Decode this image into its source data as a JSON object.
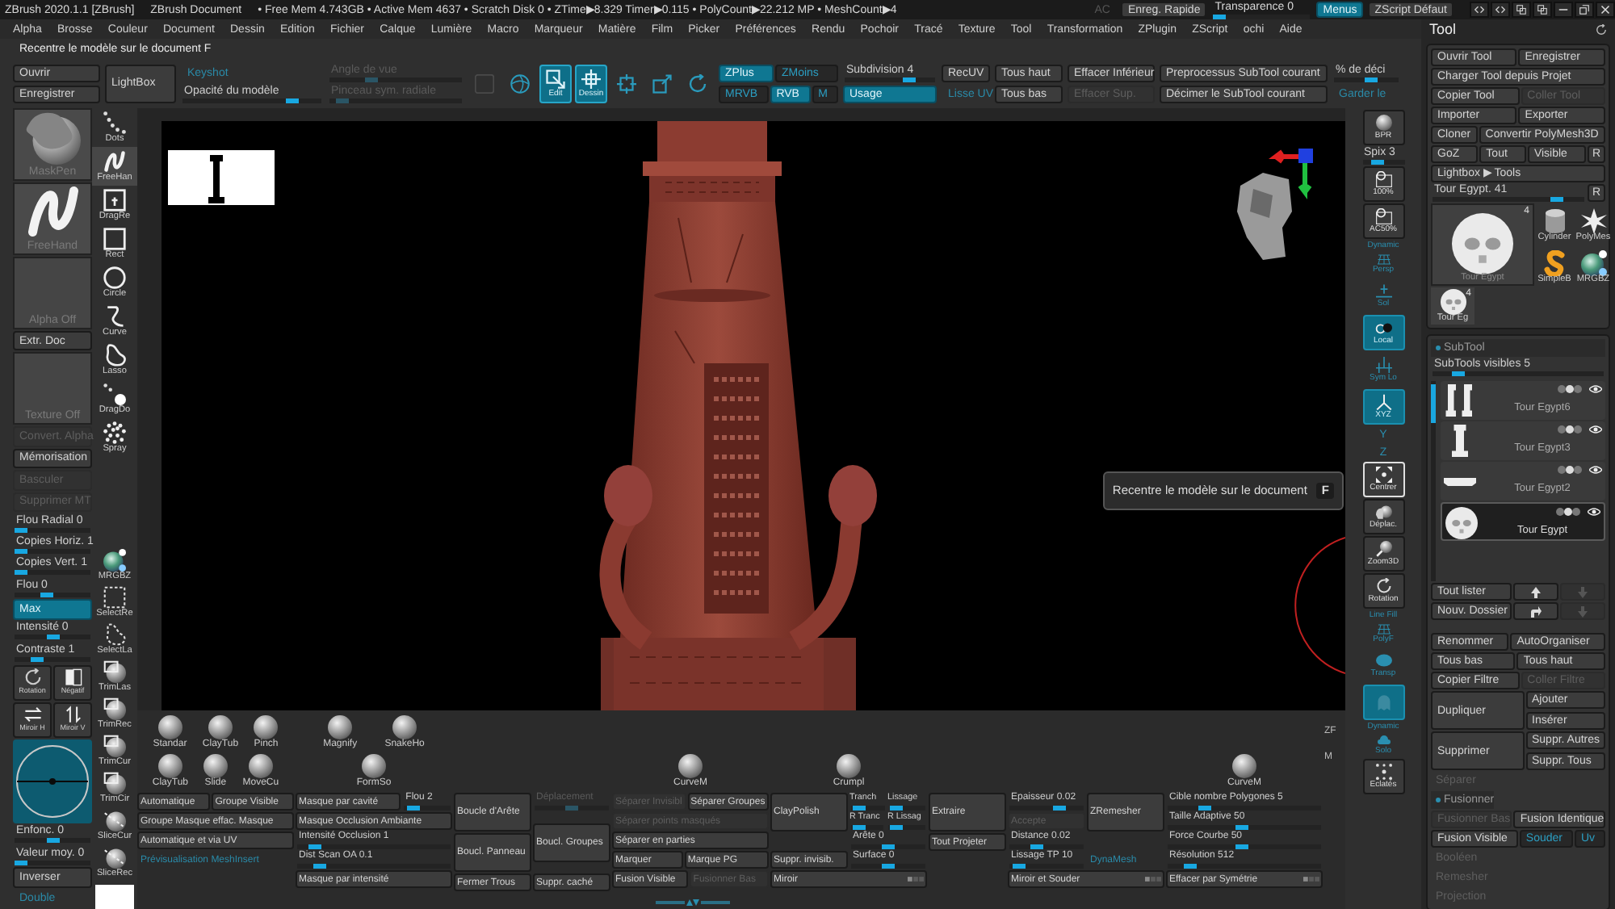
{
  "title_bar": {
    "app": "ZBrush 2020.1.1 [ZBrush]",
    "document": "ZBrush Document",
    "stats": "• Free Mem 4.743GB • Active Mem 4637 • Scratch Disk 0 • ZTime▶8.329 Timer▶0.115 • PolyCount▶22.212 MP • MeshCount▶4",
    "controls": [
      {
        "kind": "note",
        "label": "AC",
        "disabled": true
      },
      {
        "kind": "button",
        "label": "Enreg. Rapide",
        "disabled": false
      },
      {
        "kind": "slider",
        "label": "Transparence 0",
        "level": 0,
        "disabled": false
      },
      {
        "kind": "toggle",
        "label": "Menus",
        "on": true,
        "disabled": false
      },
      {
        "kind": "button",
        "label": "ZScript Défaut",
        "disabled": false
      }
    ]
  },
  "menu_bar": [
    "Alpha",
    "Brosse",
    "Couleur",
    "Document",
    "Dessin",
    "Edition",
    "Fichier",
    "Calque",
    "Lumière",
    "Macro",
    "Marqueur",
    "Matière",
    "Film",
    "Picker",
    "Préférences",
    "Rendu",
    "Pochoir",
    "Tracé",
    "Texture",
    "Tool",
    "Transformation",
    "ZPlugin",
    "ZScript",
    "ochi",
    "Aide"
  ],
  "hint": "Recentre le modèle sur le document F",
  "top_shelf": [
    {
      "kind": "block",
      "rows": [
        [
          {
            "kind": "button",
            "label": "Ouvrir",
            "disabled": false
          }
        ],
        [
          {
            "kind": "button",
            "label": "Enregistrer",
            "disabled": false
          }
        ]
      ]
    },
    {
      "kind": "block",
      "rows": [
        [
          {
            "kind": "big",
            "label": "LightBox",
            "disabled": false
          }
        ]
      ]
    },
    {
      "kind": "block",
      "rows": [
        [
          {
            "kind": "note",
            "label": "Keyshot",
            "disabled": false
          }
        ],
        [
          {
            "kind": "slider",
            "label": "Opacité du modèle",
            "level": 0.82,
            "disabled": false
          }
        ]
      ]
    },
    {
      "kind": "block",
      "rows": [
        [
          {
            "kind": "slider",
            "label": "Angle de vue",
            "level": 0.3,
            "disabled": true
          }
        ],
        [
          {
            "kind": "slider",
            "label": "Pinceau sym. radiale",
            "level": 0.05,
            "disabled": true
          }
        ]
      ]
    },
    {
      "kind": "tools",
      "items": [
        {
          "disabled": true,
          "on": false
        },
        {
          "disabled": false,
          "on": false
        },
        {
          "label": "Edit",
          "disabled": false,
          "on": true
        },
        {
          "label": "Dessin",
          "disabled": false,
          "on": true
        },
        {
          "disabled": false,
          "on": false
        },
        {
          "disabled": false,
          "on": false
        },
        {
          "disabled": false,
          "on": false
        }
      ]
    },
    {
      "kind": "block",
      "rows": [
        [
          {
            "kind": "toggle",
            "label": "ZPlus",
            "on": true
          },
          {
            "kind": "toggle",
            "label": "ZMoins",
            "on": false
          }
        ],
        [
          {
            "kind": "toggle",
            "label": "MRVB",
            "on": false
          },
          {
            "kind": "toggle",
            "label": "RVB",
            "on": true
          },
          {
            "kind": "toggle",
            "label": "M",
            "on": false
          }
        ]
      ]
    },
    {
      "kind": "block",
      "rows": [
        [
          {
            "kind": "slider",
            "label": "Subdivision 4",
            "level": 0.75,
            "disabled": false
          }
        ],
        [
          {
            "kind": "toggle",
            "label": "Usage",
            "on": true
          }
        ]
      ]
    },
    {
      "kind": "block",
      "rows": [
        [
          {
            "kind": "button",
            "label": "RecUV",
            "disabled": false
          }
        ],
        [
          {
            "kind": "note",
            "label": "Lisse UV",
            "disabled": false
          }
        ]
      ]
    },
    {
      "kind": "block",
      "rows": [
        [
          {
            "kind": "button",
            "label": "Tous haut",
            "disabled": false
          }
        ],
        [
          {
            "kind": "button",
            "label": "Tous bas",
            "disabled": false
          }
        ]
      ]
    },
    {
      "kind": "block",
      "rows": [
        [
          {
            "kind": "button",
            "label": "Effacer Inférieur",
            "disabled": false
          }
        ],
        [
          {
            "kind": "button",
            "label": "Effacer Sup.",
            "disabled": true
          }
        ]
      ]
    },
    {
      "kind": "block",
      "rows": [
        [
          {
            "kind": "button",
            "label": "Preprocessus SubTool courant",
            "disabled": false
          }
        ],
        [
          {
            "kind": "button",
            "label": "Décimer le SubTool courant",
            "disabled": false
          }
        ]
      ]
    },
    {
      "kind": "block",
      "rows": [
        [
          {
            "kind": "slider",
            "label": "% de déci",
            "level": 0.6,
            "disabled": false
          }
        ],
        [
          {
            "kind": "note",
            "label": "Garder le",
            "disabled": false
          }
        ]
      ]
    }
  ],
  "left_panel": {
    "main": [
      {
        "kind": "brush-thumb",
        "label": "MaskPen"
      },
      {
        "kind": "stroke-thumb",
        "label": "FreeHand"
      },
      {
        "kind": "empty-thumb",
        "label": "Alpha Off"
      },
      {
        "kind": "button",
        "label": "Extr. Doc",
        "disabled": false
      },
      {
        "kind": "empty-thumb",
        "label": "Texture Off"
      },
      {
        "kind": "button",
        "label": "Convert. Alpha",
        "disabled": true
      },
      {
        "kind": "button",
        "label": "Mémorisation",
        "disabled": false
      },
      {
        "kind": "button",
        "label": "Basculer",
        "disabled": true
      },
      {
        "kind": "button",
        "label": "Supprimer MT",
        "disabled": true
      },
      {
        "kind": "slider",
        "label": "Flou Radial 0",
        "level": 0,
        "disabled": false
      },
      {
        "kind": "slider",
        "label": "Copies Horiz. 1",
        "level": 0,
        "disabled": false
      },
      {
        "kind": "slider",
        "label": "Copies Vert. 1",
        "level": 0,
        "disabled": false
      },
      {
        "kind": "slider",
        "label": "Flou 0",
        "level": 0.4,
        "disabled": false
      },
      {
        "kind": "toggle",
        "label": "Max",
        "on": true,
        "disabled": false
      },
      {
        "kind": "slider",
        "label": "Intensité 0",
        "level": 0.5,
        "disabled": false
      },
      {
        "kind": "slider",
        "label": "Contraste 1",
        "level": 0.25,
        "disabled": false
      },
      {
        "kind": "icons",
        "items": [
          {
            "label": "Rotation"
          },
          {
            "label": "Négatif"
          },
          {
            "label": "Miroir H"
          },
          {
            "label": "Miroir V"
          }
        ]
      },
      {
        "kind": "dial"
      },
      {
        "kind": "slider",
        "label": "Enfonc. 0",
        "level": 0.5,
        "disabled": false
      },
      {
        "kind": "slider",
        "label": "Valeur moy. 0",
        "level": 0,
        "disabled": false
      },
      {
        "kind": "button",
        "label": "Inverser",
        "disabled": false
      },
      {
        "kind": "note",
        "label": "Double",
        "disabled": false
      }
    ],
    "strokes": [
      {
        "label": "Dots",
        "selected": false
      },
      {
        "label": "FreeHan",
        "selected": true
      },
      {
        "label": "DragRe",
        "selected": false
      },
      {
        "label": "Rect",
        "selected": false
      },
      {
        "label": "Circle",
        "selected": false
      },
      {
        "label": "Curve",
        "selected": false
      },
      {
        "label": "Lasso",
        "selected": false
      },
      {
        "label": "DragDo",
        "selected": false
      },
      {
        "label": "Spray",
        "selected": false
      }
    ],
    "tools": [
      "MRGBZ",
      "SelectRe",
      "SelectLa",
      "TrimLas",
      "TrimRec",
      "TrimCur",
      "TrimCir",
      "SliceCur",
      "SliceRec"
    ]
  },
  "viewport": {
    "tooltip": {
      "text": "Recentre le modèle sur le document",
      "shortcut": "F"
    }
  },
  "bottom_panel": {
    "groups": [
      {
        "kind": "wide",
        "brushes_top": [
          "Standar",
          "ClayTub",
          "Pinch"
        ],
        "brushes_bottom": [
          "ClayTub",
          "Slide",
          "MoveCu"
        ],
        "rows": [
          [
            {
              "kind": "button",
              "label": "Automatique",
              "disabled": false
            },
            {
              "kind": "button",
              "label": "Groupe Visible",
              "disabled": false
            }
          ],
          [
            {
              "kind": "button",
              "label": "Groupe Masque effac. Masque",
              "disabled": false
            }
          ],
          [
            {
              "kind": "button",
              "label": "Automatique et via UV",
              "disabled": false
            }
          ],
          [
            {
              "kind": "note",
              "label": "Prévisualisation MeshInsert",
              "disabled": false
            }
          ]
        ]
      },
      {
        "kind": "wide",
        "brushes_top": [
          "Magnify",
          "SnakeHo"
        ],
        "brushes_bottom": [
          "FormSo"
        ],
        "rows": [
          [
            {
              "kind": "button",
              "label": "Masque par cavité",
              "disabled": false
            },
            {
              "kind": "slider",
              "label": "Flou 2",
              "level": 0.1,
              "disabled": false
            }
          ],
          [
            {
              "kind": "button",
              "label": "Masque Occlusion Ambiante",
              "disabled": false
            }
          ],
          [
            {
              "kind": "slider",
              "label": "Intensité Occlusion 1",
              "level": 0.08,
              "disabled": false
            }
          ],
          [
            {
              "kind": "slider",
              "label": "Dist Scan OA 0.1",
              "level": 0.12,
              "disabled": false
            }
          ],
          [
            {
              "kind": "button",
              "label": "Masque par intensité",
              "disabled": false
            }
          ]
        ]
      },
      {
        "kind": "wide",
        "rows": [
          [
            {
              "kind": "stack",
              "items": [
                {
                  "kind": "big",
                  "label": "Boucle d'Arête",
                  "disabled": false
                },
                {
                  "kind": "big",
                  "label": "Boucl. Panneau",
                  "disabled": false
                },
                {
                  "kind": "button",
                  "label": "Fermer Trous",
                  "disabled": false
                }
              ]
            },
            {
              "kind": "stack",
              "items": [
                {
                  "kind": "slider",
                  "label": "Déplacement",
                  "level": 0.5,
                  "disabled": true
                },
                {
                  "kind": "big",
                  "label": "Boucl. Groupes",
                  "disabled": false
                },
                {
                  "kind": "button",
                  "label": "Suppr. caché",
                  "disabled": false
                }
              ]
            }
          ]
        ]
      },
      {
        "kind": "wide",
        "brushes_bottom": [
          "CurveM"
        ],
        "rows": [
          [
            {
              "kind": "button",
              "label": "Séparer Invisibl",
              "disabled": true
            },
            {
              "kind": "button",
              "label": "Séparer Groupes",
              "disabled": false
            }
          ],
          [
            {
              "kind": "button",
              "label": "Séparer points masqués",
              "disabled": true
            }
          ],
          [
            {
              "kind": "button",
              "label": "Séparer en parties",
              "disabled": false
            }
          ],
          [
            {
              "kind": "button",
              "label": "Marquer",
              "disabled": false
            },
            {
              "kind": "button",
              "label": "Marque PG",
              "disabled": false
            }
          ],
          [
            {
              "kind": "button",
              "label": "Fusion Visible",
              "disabled": false
            },
            {
              "kind": "button",
              "label": "Fusionner Bas",
              "disabled": true
            }
          ]
        ]
      },
      {
        "kind": "wide",
        "brushes_bottom": [
          "Crumpl"
        ],
        "rows": [
          [
            {
              "kind": "stack",
              "items": [
                {
                  "kind": "big",
                  "label": "ClayPolish",
                  "disabled": false
                },
                {
                  "kind": "button",
                  "label": "Suppr. invisib.",
                  "disabled": false
                }
              ]
            },
            {
              "kind": "stack",
              "items": [
                {
                  "kind": "row",
                  "items": [
                    {
                      "kind": "slider",
                      "label": "Tranch",
                      "level": 0.05,
                      "disabled": false
                    },
                    {
                      "kind": "slider",
                      "label": "Lissage",
                      "level": 0.05,
                      "disabled": false
                    }
                  ]
                },
                {
                  "kind": "row",
                  "items": [
                    {
                      "kind": "slider",
                      "label": "R Tranc",
                      "level": 0.05,
                      "disabled": false
                    },
                    {
                      "kind": "slider",
                      "label": "R Lissag",
                      "level": 0.05,
                      "disabled": false
                    }
                  ]
                },
                {
                  "kind": "slider",
                  "label": "Arête 0",
                  "level": 0.5,
                  "disabled": false
                },
                {
                  "kind": "slider",
                  "label": "Surface 0",
                  "level": 0.5,
                  "disabled": false
                }
              ]
            }
          ],
          [
            {
              "kind": "menu",
              "label": "Miroir",
              "disabled": false
            }
          ]
        ]
      },
      {
        "kind": "narrow",
        "rows": [
          [
            {
              "kind": "big",
              "label": "Extraire",
              "disabled": false
            }
          ],
          [
            {
              "kind": "button",
              "label": "Tout Projeter",
              "disabled": false
            }
          ]
        ]
      },
      {
        "kind": "wide",
        "rows": [
          [
            {
              "kind": "stack",
              "items": [
                {
                  "kind": "slider",
                  "label": "Epaisseur 0.02",
                  "level": 0.7,
                  "disabled": false
                },
                {
                  "kind": "button",
                  "label": "Accepte",
                  "disabled": true
                },
                {
                  "kind": "slider",
                  "label": "Distance 0.02",
                  "level": 0.35,
                  "disabled": false
                },
                {
                  "kind": "slider",
                  "label": "Lissage TP 10",
                  "level": 0.05,
                  "disabled": false
                }
              ]
            },
            {
              "kind": "stack",
              "items": [
                {
                  "kind": "big",
                  "label": "ZRemesher",
                  "disabled": false
                },
                {
                  "kind": "note",
                  "label": "DynaMesh",
                  "disabled": false
                }
              ]
            }
          ],
          [
            {
              "kind": "menu",
              "label": "Miroir et Souder",
              "disabled": false
            }
          ]
        ]
      },
      {
        "kind": "wide",
        "brushes_bottom": [
          "CurveM"
        ],
        "rows": [
          [
            {
              "kind": "slider",
              "label": "Cible nombre Polygones 5",
              "level": 0.22,
              "disabled": false
            }
          ],
          [
            {
              "kind": "slider",
              "label": "Taille Adaptive 50",
              "level": 0.48,
              "disabled": false
            }
          ],
          [
            {
              "kind": "slider",
              "label": "Force Courbe 50",
              "level": 0.48,
              "disabled": false
            }
          ],
          [
            {
              "kind": "slider",
              "label": "Résolution 512",
              "level": 0.12,
              "disabled": false
            }
          ],
          [
            {
              "kind": "menu",
              "label": "Effacer par Symétrie",
              "disabled": false
            }
          ]
        ]
      }
    ],
    "edge": [
      "ZF",
      "M"
    ]
  },
  "right_shelf": [
    {
      "kind": "tool",
      "label": "BPR",
      "on": false,
      "hovered": false
    },
    {
      "kind": "slider",
      "label": "Spix 3",
      "level": 0.3,
      "disabled": false
    },
    {
      "kind": "tool",
      "label": "100%",
      "on": false,
      "hovered": false
    },
    {
      "kind": "tool",
      "label": "AC50%",
      "on": false,
      "hovered": false
    },
    {
      "kind": "toggle",
      "heading": "Dynamic",
      "label": "Persp",
      "on": false,
      "hovered": false
    },
    {
      "kind": "toggle",
      "label": "Sol",
      "on": false,
      "hovered": false
    },
    {
      "kind": "tool",
      "label": "Local",
      "on": true,
      "hovered": false
    },
    {
      "kind": "toggle",
      "label": "Sym Lo",
      "on": false,
      "hovered": false
    },
    {
      "kind": "tool",
      "label": "XYZ",
      "on": true,
      "hovered": false
    },
    {
      "kind": "letter",
      "label": "Y",
      "on": false,
      "hovered": false
    },
    {
      "kind": "letter",
      "label": "Z",
      "on": false,
      "hovered": false
    },
    {
      "kind": "tool",
      "label": "Centrer",
      "on": false,
      "hovered": true
    },
    {
      "kind": "tool",
      "label": "Déplac.",
      "on": false,
      "hovered": false
    },
    {
      "kind": "tool",
      "label": "Zoom3D",
      "on": false,
      "hovered": false
    },
    {
      "kind": "tool",
      "label": "Rotation",
      "on": false,
      "hovered": false
    },
    {
      "kind": "toggle",
      "heading": "Line Fill",
      "label": "PolyF",
      "on": false,
      "hovered": false
    },
    {
      "kind": "toggle",
      "label": "Transp",
      "on": false,
      "hovered": false
    },
    {
      "kind": "toggle",
      "on": true,
      "hovered": false
    },
    {
      "kind": "toggle",
      "heading": "Dynamic",
      "label": "Solo",
      "on": false,
      "hovered": false
    },
    {
      "kind": "tool",
      "label": "Eclatés",
      "on": false,
      "hovered": false
    }
  ],
  "tool_palette": {
    "title": "Tool",
    "rows": [
      [
        {
          "kind": "button",
          "label": "Ouvrir Tool",
          "disabled": false
        },
        {
          "kind": "button",
          "label": "Enregistrer",
          "disabled": false
        }
      ],
      [
        {
          "kind": "button",
          "label": "Charger Tool depuis Projet",
          "disabled": false
        }
      ],
      [
        {
          "kind": "button",
          "label": "Copier Tool",
          "disabled": false
        },
        {
          "kind": "button",
          "label": "Coller Tool",
          "disabled": true
        }
      ],
      [
        {
          "kind": "button",
          "label": "Importer",
          "disabled": false
        },
        {
          "kind": "button",
          "label": "Exporter",
          "disabled": false
        }
      ],
      [
        {
          "kind": "button",
          "label": "Cloner",
          "disabled": false
        },
        {
          "kind": "button",
          "label": "Convertir PolyMesh3D",
          "disabled": false
        }
      ],
      [
        {
          "kind": "button",
          "label": "GoZ",
          "disabled": false
        },
        {
          "kind": "button",
          "label": "Tout",
          "disabled": false
        },
        {
          "kind": "button",
          "label": "Visible",
          "disabled": false
        },
        {
          "kind": "mini",
          "label": "R",
          "disabled": false
        }
      ],
      [
        {
          "kind": "button",
          "label": "Lightbox ▶ Tools",
          "disabled": false
        }
      ],
      [
        {
          "kind": "slider",
          "label": "Tour Egypt. 41",
          "level": 0.85,
          "disabled": false
        },
        {
          "kind": "mini",
          "label": "R",
          "disabled": false
        }
      ]
    ],
    "tools": [
      {
        "label": "Tour Egypt",
        "count": "4"
      },
      {
        "label": "Cylinder"
      },
      {
        "label": "PolyMes"
      },
      {
        "label": "SimpleB"
      },
      {
        "label": "MRGBZ"
      },
      {
        "label": "Tour Eg",
        "count": "4"
      }
    ],
    "subtool": {
      "header": {
        "kind": "section",
        "label": "SubTool",
        "expanded": true
      },
      "slider": {
        "kind": "slider",
        "label": "SubTools visibles 5",
        "level": 0.12,
        "disabled": false
      },
      "items": [
        {
          "name": "Tour Egypt6",
          "selected": false
        },
        {
          "name": "Tour Egypt3",
          "selected": false
        },
        {
          "name": "Tour Egypt2",
          "selected": false
        },
        {
          "name": "Tour Egypt",
          "selected": true
        }
      ],
      "actions": [
        {
          "label": "Tout lister",
          "disabled": false,
          "arrows": [
            {
              "disabled": false
            },
            {
              "disabled": true
            }
          ]
        },
        {
          "label": "Nouv. Dossier",
          "disabled": false,
          "arrows": [
            {
              "disabled": false
            },
            {
              "disabled": true
            }
          ]
        }
      ],
      "rows": [
        [
          {
            "kind": "button",
            "label": "Renommer",
            "disabled": false
          },
          {
            "kind": "button",
            "label": "AutoOrganiser",
            "disabled": false
          }
        ],
        [
          {
            "kind": "button",
            "label": "Tous bas",
            "disabled": false
          },
          {
            "kind": "button",
            "label": "Tous haut",
            "disabled": false
          }
        ],
        [
          {
            "kind": "button",
            "label": "Copier Filtre",
            "disabled": false
          },
          {
            "kind": "button",
            "label": "Coller Filtre",
            "disabled": true
          }
        ],
        [
          {
            "kind": "big",
            "label": "Dupliquer",
            "disabled": false
          },
          {
            "kind": "stack",
            "items": [
              {
                "kind": "button",
                "label": "Ajouter",
                "disabled": false
              },
              {
                "kind": "button",
                "label": "Insérer",
                "disabled": false
              }
            ]
          }
        ],
        [
          {
            "kind": "big",
            "label": "Supprimer",
            "disabled": false
          },
          {
            "kind": "stack",
            "items": [
              {
                "kind": "button",
                "label": "Suppr. Autres",
                "disabled": false
              },
              {
                "kind": "button",
                "label": "Suppr. Tous",
                "disabled": false
              }
            ]
          }
        ],
        [
          {
            "kind": "section",
            "label": "Séparer",
            "expanded": false
          }
        ],
        [
          {
            "kind": "section",
            "label": "Fusionner",
            "expanded": true
          }
        ],
        [
          {
            "kind": "button",
            "label": "Fusionner Bas",
            "disabled": true
          },
          {
            "kind": "button",
            "label": "Fusion Identique",
            "disabled": false
          }
        ],
        [
          {
            "kind": "button",
            "label": "Fusion Visible",
            "disabled": false
          },
          {
            "kind": "toggle",
            "label": "Souder",
            "on": false
          },
          {
            "kind": "toggle",
            "label": "Uv",
            "on": false
          }
        ],
        [
          {
            "kind": "section",
            "label": "Booléen",
            "expanded": false
          }
        ],
        [
          {
            "kind": "section",
            "label": "Remesher",
            "expanded": false
          }
        ],
        [
          {
            "kind": "section",
            "label": "Projection",
            "expanded": false
          }
        ]
      ]
    }
  }
}
